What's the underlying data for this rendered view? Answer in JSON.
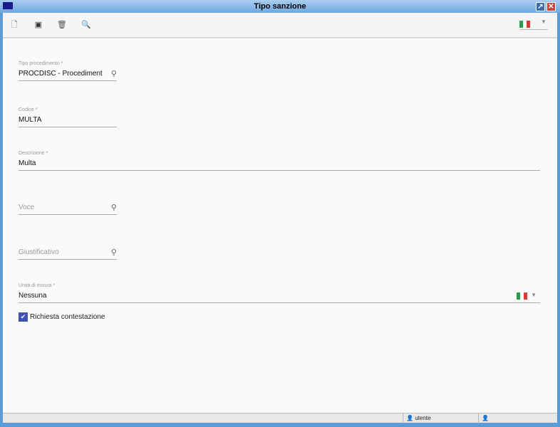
{
  "window": {
    "title": "Tipo sanzione"
  },
  "toolbar": {
    "icons": [
      "new-icon",
      "save-icon",
      "delete-icon",
      "search-icon"
    ]
  },
  "form": {
    "tipo_procedimento": {
      "label": "Tipo procedimento *",
      "value": "PROCDISC - Procediment"
    },
    "codice": {
      "label": "Codice *",
      "value": "MULTA"
    },
    "descrizione": {
      "label": "Descrizione *",
      "value": "Multa"
    },
    "voce": {
      "placeholder": "Voce"
    },
    "giustificativo": {
      "placeholder": "Giustificativo"
    },
    "unita_misura": {
      "label": "Unità di misura *",
      "value": "Nessuna"
    },
    "richiesta_contestazione": {
      "label": "Richiesta contestazione",
      "checked": true
    }
  },
  "statusbar": {
    "user": "utente"
  }
}
